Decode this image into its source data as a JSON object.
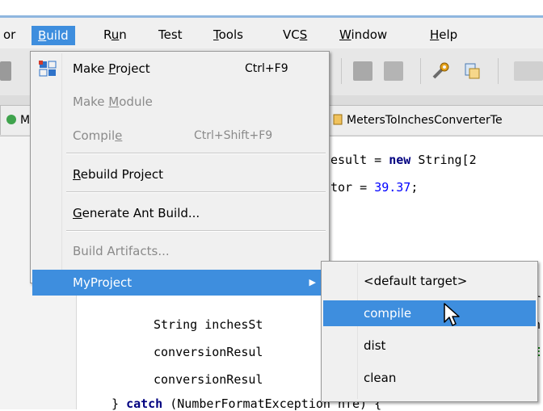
{
  "menubar": {
    "items": [
      {
        "label": "or",
        "key": ""
      },
      {
        "label": "Build",
        "key": "B"
      },
      {
        "label": "Run",
        "key": "u"
      },
      {
        "label": "Test",
        "key": ""
      },
      {
        "label": "Tools",
        "key": "T"
      },
      {
        "label": "VCS",
        "key": "S"
      },
      {
        "label": "Window",
        "key": "W"
      },
      {
        "label": "Help",
        "key": "H"
      }
    ]
  },
  "tabs": [
    {
      "label": "M"
    },
    {
      "label": "MetersToInchesConverterTe"
    }
  ],
  "build_menu": {
    "make_project": {
      "pre": "Make ",
      "key": "P",
      "post": "roject",
      "shortcut": "Ctrl+F9"
    },
    "make_module": {
      "pre": "Make ",
      "key": "M",
      "post": "odule"
    },
    "compile": {
      "pre": "Compil",
      "key": "e",
      "post": "",
      "shortcut": "Ctrl+Shift+F9"
    },
    "rebuild_project": {
      "pre": "",
      "key": "R",
      "post": "ebuild Project"
    },
    "generate_ant": {
      "pre": "",
      "key": "G",
      "post": "enerate Ant Build..."
    },
    "build_artifacts": {
      "label": "Build Artifacts..."
    },
    "myproject": {
      "label": "MyProject",
      "arrow": "▶"
    }
  },
  "sub_menu": {
    "items": [
      {
        "label": "<default target>"
      },
      {
        "label": "compile"
      },
      {
        "label": "dist"
      },
      {
        "label": "clean"
      }
    ]
  },
  "code": {
    "line1": {
      "t1": "esult = ",
      "kw": "new",
      "t2": " String[2"
    },
    "line2": {
      "t1": "tor = ",
      "num": "39.37",
      "t2": ";"
    },
    "line3": {
      "t1": "l"
    },
    "line4": {
      "t1": "er"
    },
    "line5": {
      "left": "String inchesSt",
      "right": "in"
    },
    "line6": {
      "left": "conversionResul",
      "right": "RE"
    },
    "line7": {
      "left": "conversionResul",
      "right": "t"
    },
    "line8": {
      "pre": "} ",
      "kw": "catch",
      "post": " (NumberFormatException nfe) {"
    }
  },
  "colors": {
    "accent": "#3e8ede",
    "string": "#008000",
    "keyword": "#000080",
    "number": "#0000ff"
  }
}
